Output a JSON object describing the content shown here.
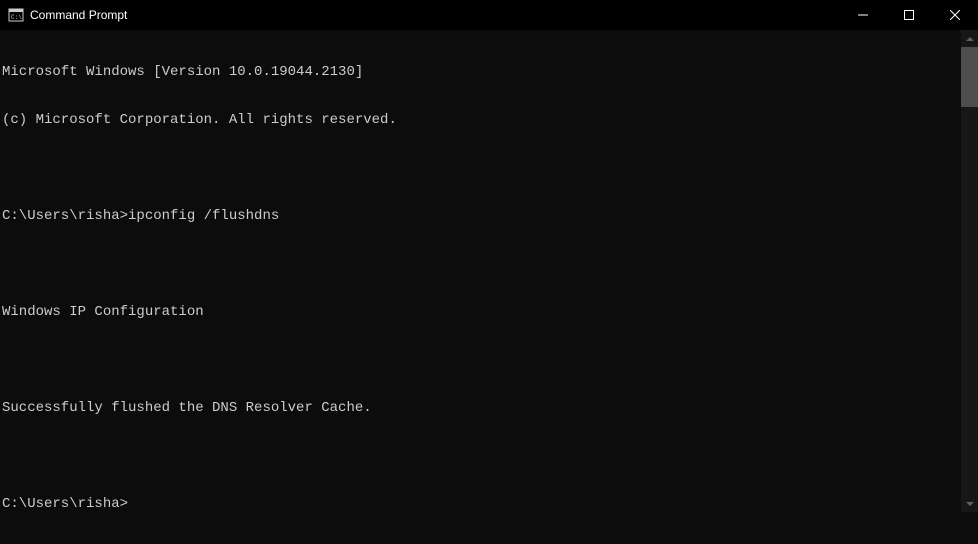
{
  "titlebar": {
    "title": "Command Prompt"
  },
  "terminal": {
    "lines": [
      "Microsoft Windows [Version 10.0.19044.2130]",
      "(c) Microsoft Corporation. All rights reserved.",
      "",
      "C:\\Users\\risha>ipconfig /flushdns",
      "",
      "Windows IP Configuration",
      "",
      "Successfully flushed the DNS Resolver Cache.",
      "",
      "C:\\Users\\risha>"
    ]
  }
}
